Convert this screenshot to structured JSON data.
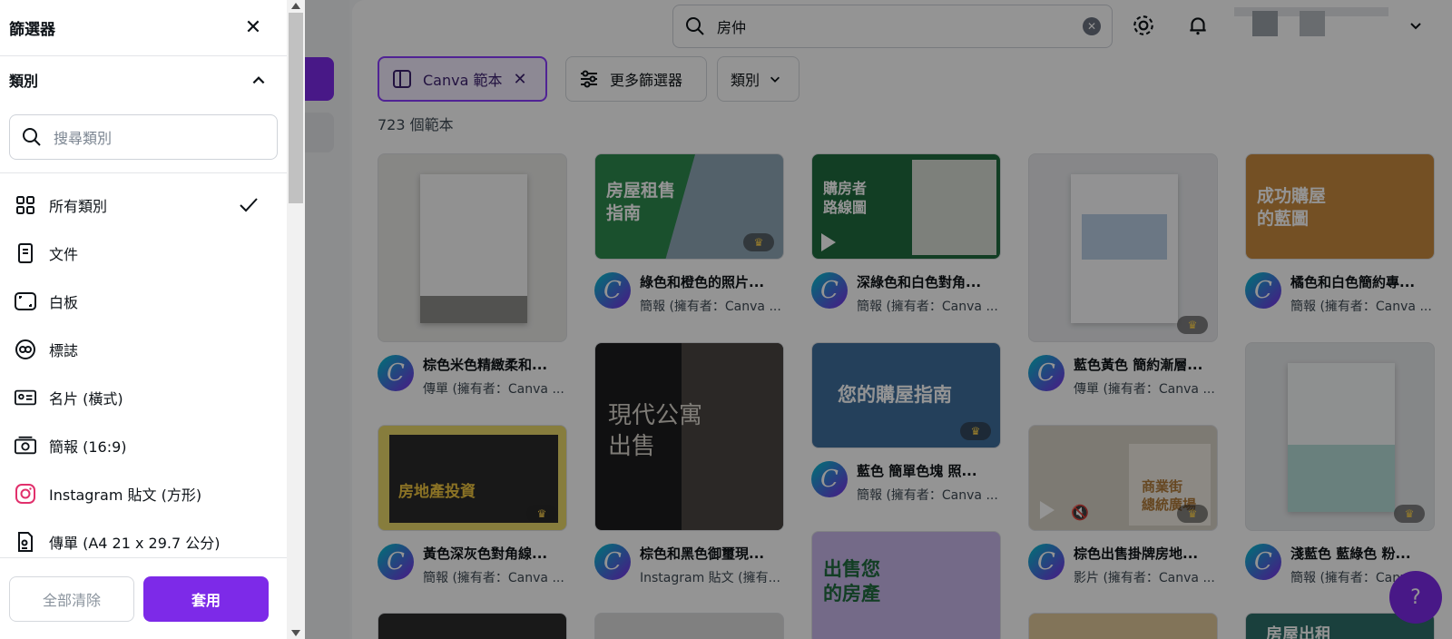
{
  "search": {
    "query": "房仲"
  },
  "filters": {
    "active_chip": "Canva 範本",
    "more_filters": "更多篩選器",
    "category_dropdown": "類別"
  },
  "result_count": "723 個範本",
  "cards": [
    {
      "title": "棕色米色精緻柔和...",
      "subtitle": "傳單 (擁有者：Canva ...",
      "thumb_text": ""
    },
    {
      "title": "綠色和橙色的照片...",
      "subtitle": "簡報 (擁有者：Canva ...",
      "thumb_text": "房屋租售\n指南"
    },
    {
      "title": "深綠色和白色對角...",
      "subtitle": "簡報 (擁有者：Canva ...",
      "thumb_text": "購房者\n路線圖"
    },
    {
      "title": "藍色黃色 簡約漸層...",
      "subtitle": "傳單 (擁有者：Canva ...",
      "thumb_text": ""
    },
    {
      "title": "橘色和白色簡約專...",
      "subtitle": "簡報 (擁有者：Canva ...",
      "thumb_text": "成功購屋\n的藍圖"
    },
    {
      "title": "黃色深灰色對角線...",
      "subtitle": "簡報 (擁有者：Canva ...",
      "thumb_text": "房地產投資"
    },
    {
      "title": "棕色和黑色御璽現...",
      "subtitle": "Instagram 貼文 (擁有...",
      "thumb_text": "現代公寓\n出售"
    },
    {
      "title": "藍色 簡單色塊 照...",
      "subtitle": "簡報 (擁有者：Canva ...",
      "thumb_text": "您的購屋指南"
    },
    {
      "title": "棕色出售掛牌房地...",
      "subtitle": "影片 (擁有者：Canva ...",
      "thumb_text": "商業街\n總統廣場"
    },
    {
      "title": "淺藍色 藍綠色 粉...",
      "subtitle": "簡報 (擁有者：Canva ...",
      "thumb_text": ""
    },
    {
      "title": "",
      "subtitle": "",
      "thumb_text": "出售您\n的房產"
    },
    {
      "title": "",
      "subtitle": "",
      "thumb_text": "房屋出租"
    }
  ],
  "panel": {
    "title": "篩選器",
    "category_label": "類別",
    "category_search_placeholder": "搜尋類別",
    "options": [
      {
        "label": "所有類別",
        "icon": "grid-icon",
        "selected": true
      },
      {
        "label": "文件",
        "icon": "document-icon",
        "selected": false
      },
      {
        "label": "白板",
        "icon": "whiteboard-icon",
        "selected": false
      },
      {
        "label": "標誌",
        "icon": "logo-icon",
        "selected": false
      },
      {
        "label": "名片 (橫式)",
        "icon": "business-card-icon",
        "selected": false
      },
      {
        "label": "簡報 (16:9)",
        "icon": "presentation-icon",
        "selected": false
      },
      {
        "label": "Instagram 貼文 (方形)",
        "icon": "instagram-icon",
        "selected": false
      },
      {
        "label": "傳單 (A4 21 x 29.7 公分)",
        "icon": "flyer-icon",
        "selected": false
      }
    ],
    "clear_all": "全部清除",
    "apply": "套用"
  },
  "help_label": "?",
  "colors": {
    "brand": "#7d2ae8"
  }
}
